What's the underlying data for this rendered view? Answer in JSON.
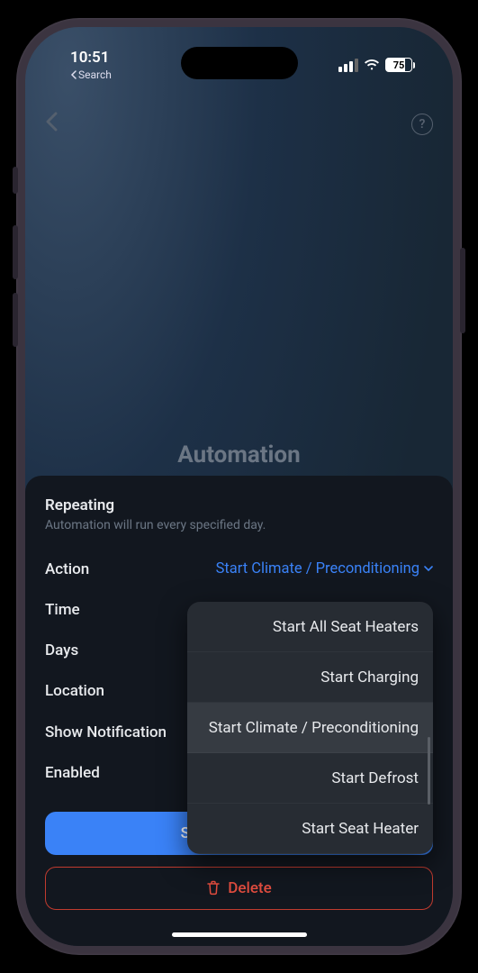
{
  "status_bar": {
    "time": "10:51",
    "back_text": "Search",
    "battery": "75"
  },
  "screen_title": "Automation",
  "sheet": {
    "section_title": "Repeating",
    "section_sub": "Automation will run every specified day.",
    "rows": {
      "action": {
        "label": "Action",
        "value": "Start Climate / Preconditioning"
      },
      "time": {
        "label": "Time"
      },
      "days": {
        "label": "Days"
      },
      "location": {
        "label": "Location"
      },
      "notify": {
        "label": "Show Notification"
      },
      "enabled": {
        "label": "Enabled"
      }
    },
    "save_label": "Save Automation",
    "delete_label": "Delete"
  },
  "dropdown": {
    "items": [
      "Start All Seat Heaters",
      "Start Charging",
      "Start Climate / Preconditioning",
      "Start Defrost",
      "Start Seat Heater"
    ],
    "selected_index": 2
  }
}
